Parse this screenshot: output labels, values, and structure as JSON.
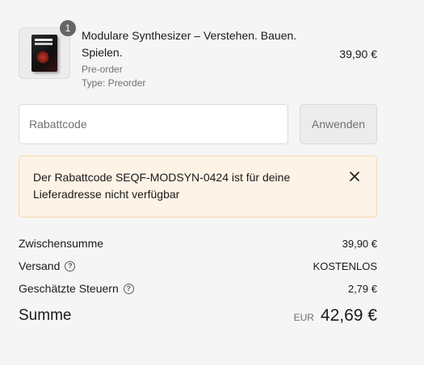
{
  "product": {
    "quantity": "1",
    "title": "Modulare Synthesizer – Verstehen. Bauen. Spielen.",
    "preorder": "Pre-order",
    "type": "Type: Preorder",
    "price": "39,90 €"
  },
  "discount": {
    "placeholder": "Rabattcode",
    "apply_label": "Anwenden"
  },
  "error": {
    "message": "Der Rabattcode SEQF-MODSYN-0424 ist für deine Lieferadresse nicht verfügbar"
  },
  "summary": {
    "subtotal_label": "Zwischensumme",
    "subtotal_value": "39,90 €",
    "shipping_label": "Versand",
    "shipping_value": "KOSTENLOS",
    "taxes_label": "Geschätzte Steuern",
    "taxes_value": "2,79 €",
    "total_label": "Summe",
    "currency": "EUR",
    "total_value": "42,69 €"
  },
  "icons": {
    "help": "question-circle-icon",
    "close": "close-icon"
  },
  "colors": {
    "error_bg": "#fdf3e6",
    "error_border": "#f4d9ad",
    "badge": "#666666"
  }
}
